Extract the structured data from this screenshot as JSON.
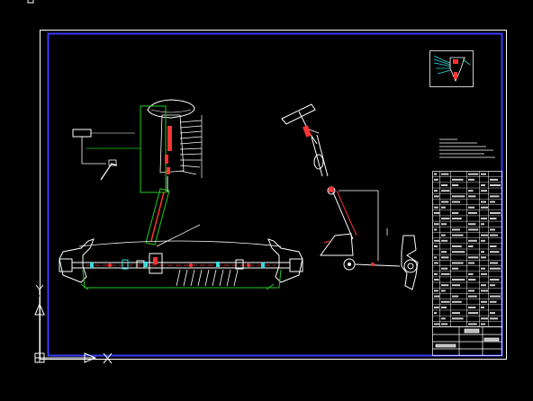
{
  "drawing": {
    "background": "#000000",
    "colors": {
      "frame": "#ffffff",
      "border": "#3333ff",
      "geometry": "#ffffff",
      "highlight_green": "#22cc22",
      "accent_red": "#ff3333",
      "accent_cyan": "#33dddd"
    },
    "ucs_icon": {
      "x_axis": "X",
      "y_axis": "Y"
    },
    "views": [
      "front-view-steering-column-and-rack",
      "side-view-steering-column",
      "detail-view-top-right"
    ],
    "parts_table": {
      "rows": 28,
      "columns": 6
    }
  }
}
